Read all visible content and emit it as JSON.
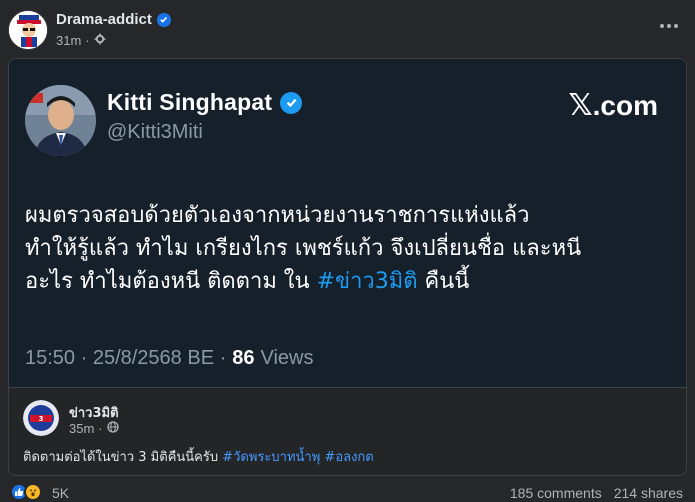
{
  "post": {
    "page_name": "Drama-addict",
    "time": "31m",
    "separator": "·"
  },
  "tweet": {
    "name": "Kitti  Singhapat",
    "handle": "@Kitti3Miti",
    "logo_x": "𝕏",
    "logo_text": ".com",
    "text_line1": "ผมตรวจสอบด้วยตัวเองจากหน่วยงานราชการแห่งแล้ว",
    "text_line2": "ทำให้รู้แล้ว ทำไม เกรียงไกร เพชร์แก้ว จึงเปลี่ยนชื่อ และหนี",
    "text_line3_pre": "อะไร ทำไมต้องหนี ติดตาม ใน ",
    "hashtag": "#ข่าว3มิติ",
    "text_line3_post": " คืนนี้",
    "timestamp": "15:50 · 25/8/2568 BE · ",
    "views_count": "86",
    "views_label": "Views"
  },
  "original": {
    "name": "ข่าว3มิติ",
    "time": "35m",
    "separator": "·",
    "text": "ติดตามต่อได้ในข่าว 3 มิติคืนนี้ครับ ",
    "tag1": "#วัดพระบาทน้ำพุ",
    "tag2": "#อลงกต"
  },
  "reactions": {
    "count": "5K",
    "comments": "185 comments",
    "shares": "214 shares"
  },
  "colors": {
    "accent": "#1b74e4",
    "twitter_blue": "#1d9bf0",
    "tweet_bg": "#15202b"
  }
}
